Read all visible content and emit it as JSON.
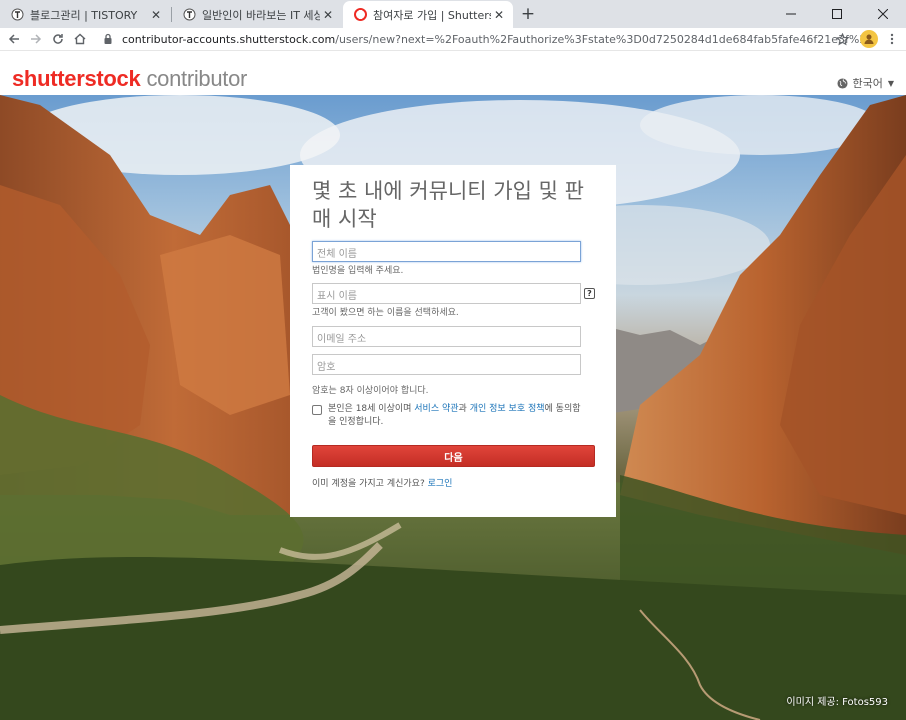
{
  "browser": {
    "tabs": [
      {
        "title": "블로그관리 | TISTORY",
        "active": false
      },
      {
        "title": "일반인이 바라보는 IT 세상",
        "active": false
      },
      {
        "title": "참여자로 가입 | Shutterstock",
        "active": true
      }
    ],
    "new_tab": "+",
    "url_host": "contributor-accounts.shutterstock.com",
    "url_rest": "/users/new?next=%2Foauth%2Fauthorize%3Fstate%3D0d7250284d1de684fab5fafe46f21e3f%26redirect_uri%3Dhttps..."
  },
  "header": {
    "brand": "shutterstock",
    "brand_sub": "contributor",
    "language": "한국어"
  },
  "signup": {
    "heading": "몇 초 내에 커뮤니티 가입 및 판매 시작",
    "full_name_placeholder": "전체 이름",
    "full_name_hint": "법인명을 입력해 주세요.",
    "display_name_placeholder": "표시 이름",
    "display_name_help": "?",
    "display_name_hint": "고객이 봤으면 하는 이름을 선택하세요.",
    "email_placeholder": "이메일 주소",
    "password_placeholder": "암호",
    "password_hint": "암호는 8자 이상이어야 합니다.",
    "terms_prefix": "본인은 18세 이상이며 ",
    "terms_link": "서비스 약관",
    "terms_and": "과 ",
    "privacy_link": "개인 정보 보호 정책",
    "terms_suffix": "에 동의함을 인정합니다.",
    "next_button": "다음",
    "login_prompt": "이미 계정을 가지고 계신가요? ",
    "login_link": "로그인"
  },
  "credit": "이미지 제공: Fotos593",
  "colors": {
    "brand_red": "#ee2b24",
    "button_red": "#d23a30",
    "link_blue": "#1a73b8"
  }
}
